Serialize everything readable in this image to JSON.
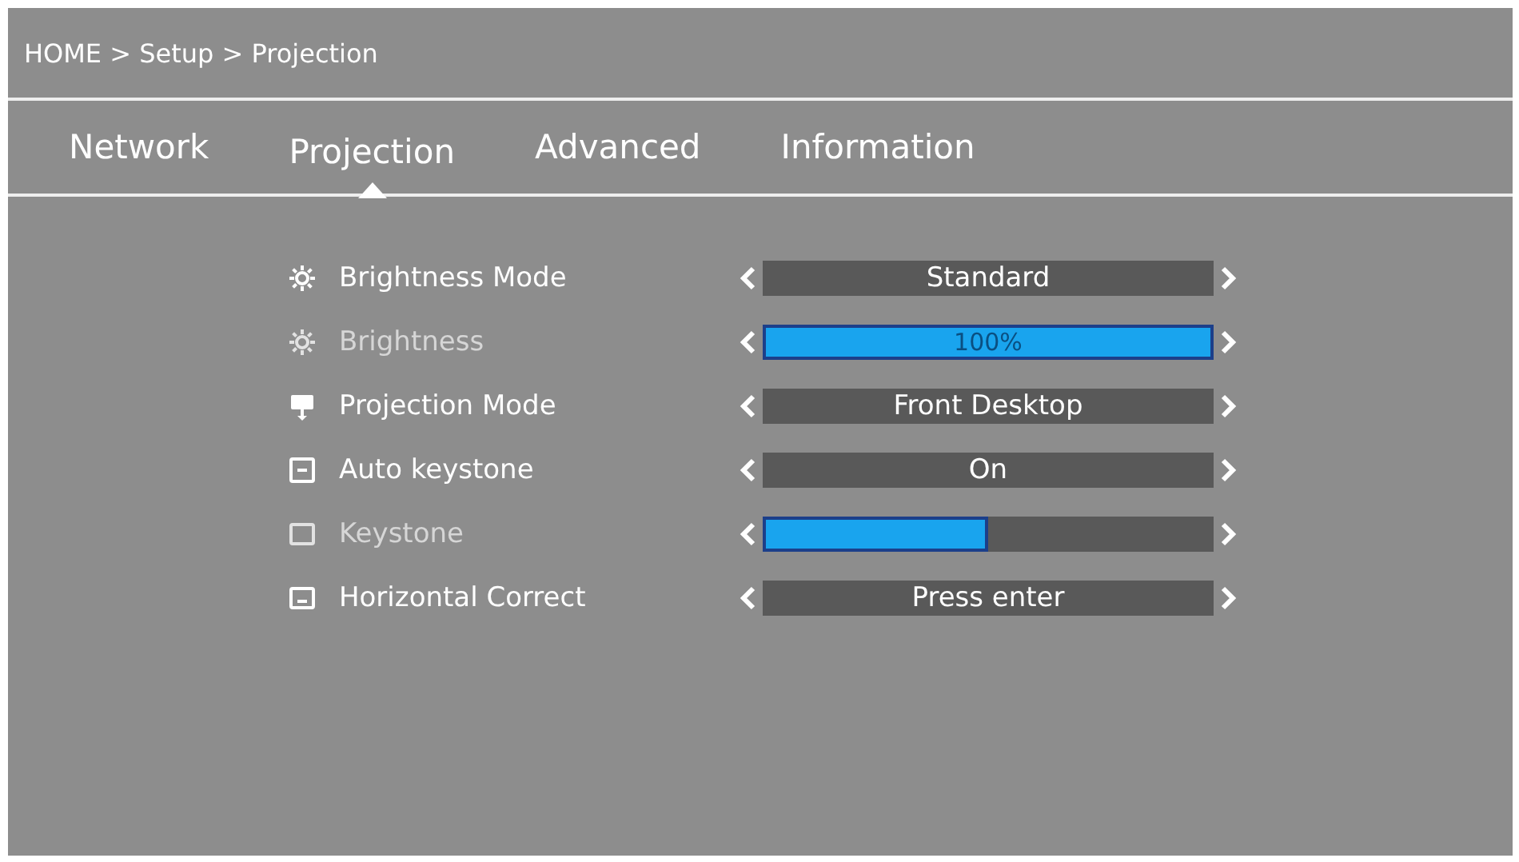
{
  "breadcrumb": "HOME > Setup > Projection",
  "tabs": [
    {
      "label": "Network",
      "selected": false
    },
    {
      "label": "Projection",
      "selected": true
    },
    {
      "label": "Advanced",
      "selected": false
    },
    {
      "label": "Information",
      "selected": false
    }
  ],
  "settings": [
    {
      "kind": "option",
      "label": "Brightness Mode",
      "value": "Standard",
      "disabled": false
    },
    {
      "kind": "slider",
      "label": "Brightness",
      "value": "100%",
      "level": 1,
      "disabled": true
    },
    {
      "kind": "option",
      "label": "Projection Mode",
      "value": "Front Desktop",
      "disabled": false
    },
    {
      "kind": "option",
      "label": "Auto keystone",
      "value": "On",
      "disabled": false
    },
    {
      "kind": "slider",
      "label": "Keystone",
      "level": 0.5,
      "disabled": true
    },
    {
      "kind": "option",
      "label": "Horizontal Correct",
      "value": "Press enter",
      "disabled": false
    }
  ]
}
